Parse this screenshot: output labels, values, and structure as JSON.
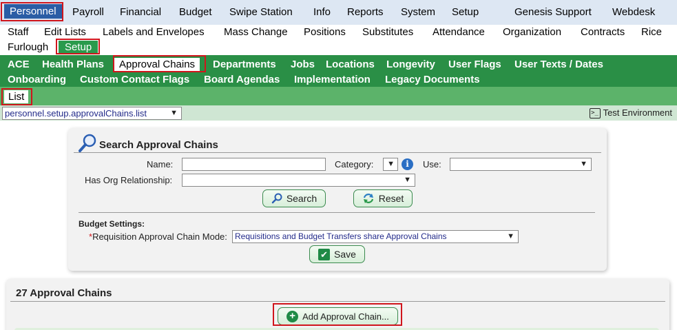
{
  "topnav": {
    "items": [
      "Personnel",
      "Payroll",
      "Financial",
      "Budget",
      "Swipe Station",
      "Info",
      "Reports",
      "System",
      "Setup",
      "Genesis Support",
      "Webdesk"
    ]
  },
  "subnav": {
    "items": [
      "Staff",
      "Edit Lists",
      "Labels and Envelopes",
      "Mass Change",
      "Positions",
      "Substitutes",
      "Attendance",
      "Organization",
      "Contracts",
      "Rice",
      "Furlough",
      "Setup"
    ]
  },
  "setupnav": {
    "items": [
      "ACE",
      "Health Plans",
      "Approval Chains",
      "Departments",
      "Jobs",
      "Locations",
      "Longevity",
      "User Flags",
      "User Texts / Dates",
      "Onboarding",
      "Custom Contact Flags",
      "Board Agendas",
      "Implementation",
      "Legacy Documents"
    ]
  },
  "listnav": {
    "label": "List"
  },
  "envbar": {
    "page_select": "personnel.setup.approvalChains.list",
    "environment": "Test Environment",
    "env_icon_glyph": ">_"
  },
  "search": {
    "title": "Search Approval Chains",
    "name_label": "Name:",
    "category_label": "Category:",
    "use_label": "Use:",
    "org_label": "Has Org Relationship:",
    "search_button": "Search",
    "reset_button": "Reset",
    "budget_settings_label": "Budget Settings:",
    "required_mark": "*",
    "mode_label": "Requisition Approval Chain Mode:",
    "mode_value": "Requisitions and Budget Transfers share Approval Chains",
    "save_button": "Save",
    "info_glyph": "i"
  },
  "chains": {
    "title": "27 Approval Chains",
    "add_button": "Add Approval Chain..."
  },
  "colors": {
    "topnav_bg": "#dde7f3",
    "active_blue": "#2a5da5",
    "green_nav": "#2a8f46",
    "list_bar": "#5cb36a",
    "highlight_red": "#d0151c"
  }
}
